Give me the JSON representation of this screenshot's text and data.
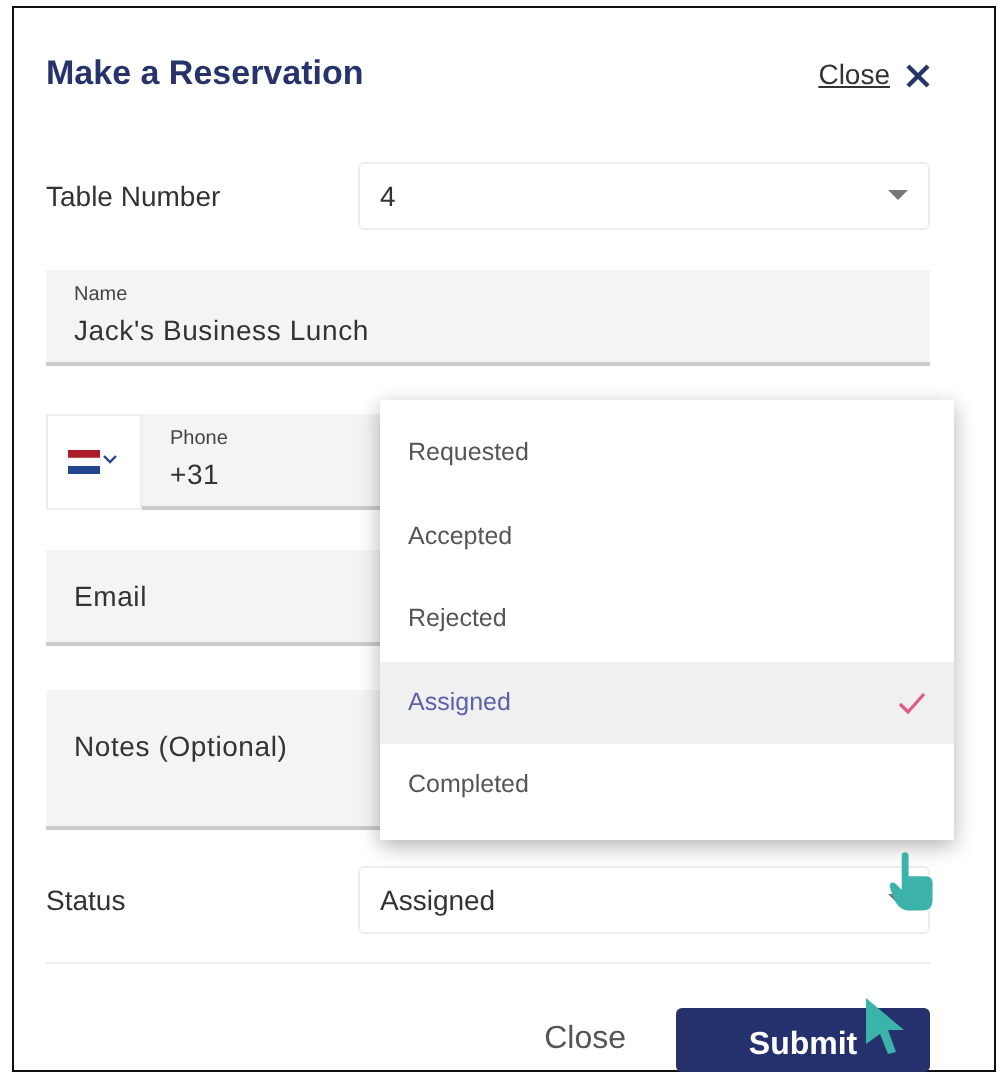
{
  "dialog": {
    "title": "Make a Reservation",
    "close_link": "Close"
  },
  "fields": [
    {
      "kind": "select",
      "label": "Table Number",
      "value": "4"
    },
    {
      "kind": "filled",
      "label": "Name",
      "value": "Jack's Business Lunch"
    },
    {
      "kind": "phone",
      "label": "Phone",
      "value": "+31"
    },
    {
      "kind": "filled",
      "placeholder": "Email"
    },
    {
      "kind": "textarea",
      "placeholder": "Notes (Optional)"
    },
    {
      "kind": "select",
      "label": "Status",
      "value": "Assigned",
      "open": true,
      "options": [
        {
          "label": "Requested",
          "selected": false
        },
        {
          "label": "Accepted",
          "selected": false
        },
        {
          "label": "Rejected",
          "selected": false
        },
        {
          "label": "Assigned",
          "selected": true
        },
        {
          "label": "Completed",
          "selected": false
        }
      ]
    }
  ],
  "footer": {
    "cancel": "Close",
    "submit": "Submit"
  }
}
